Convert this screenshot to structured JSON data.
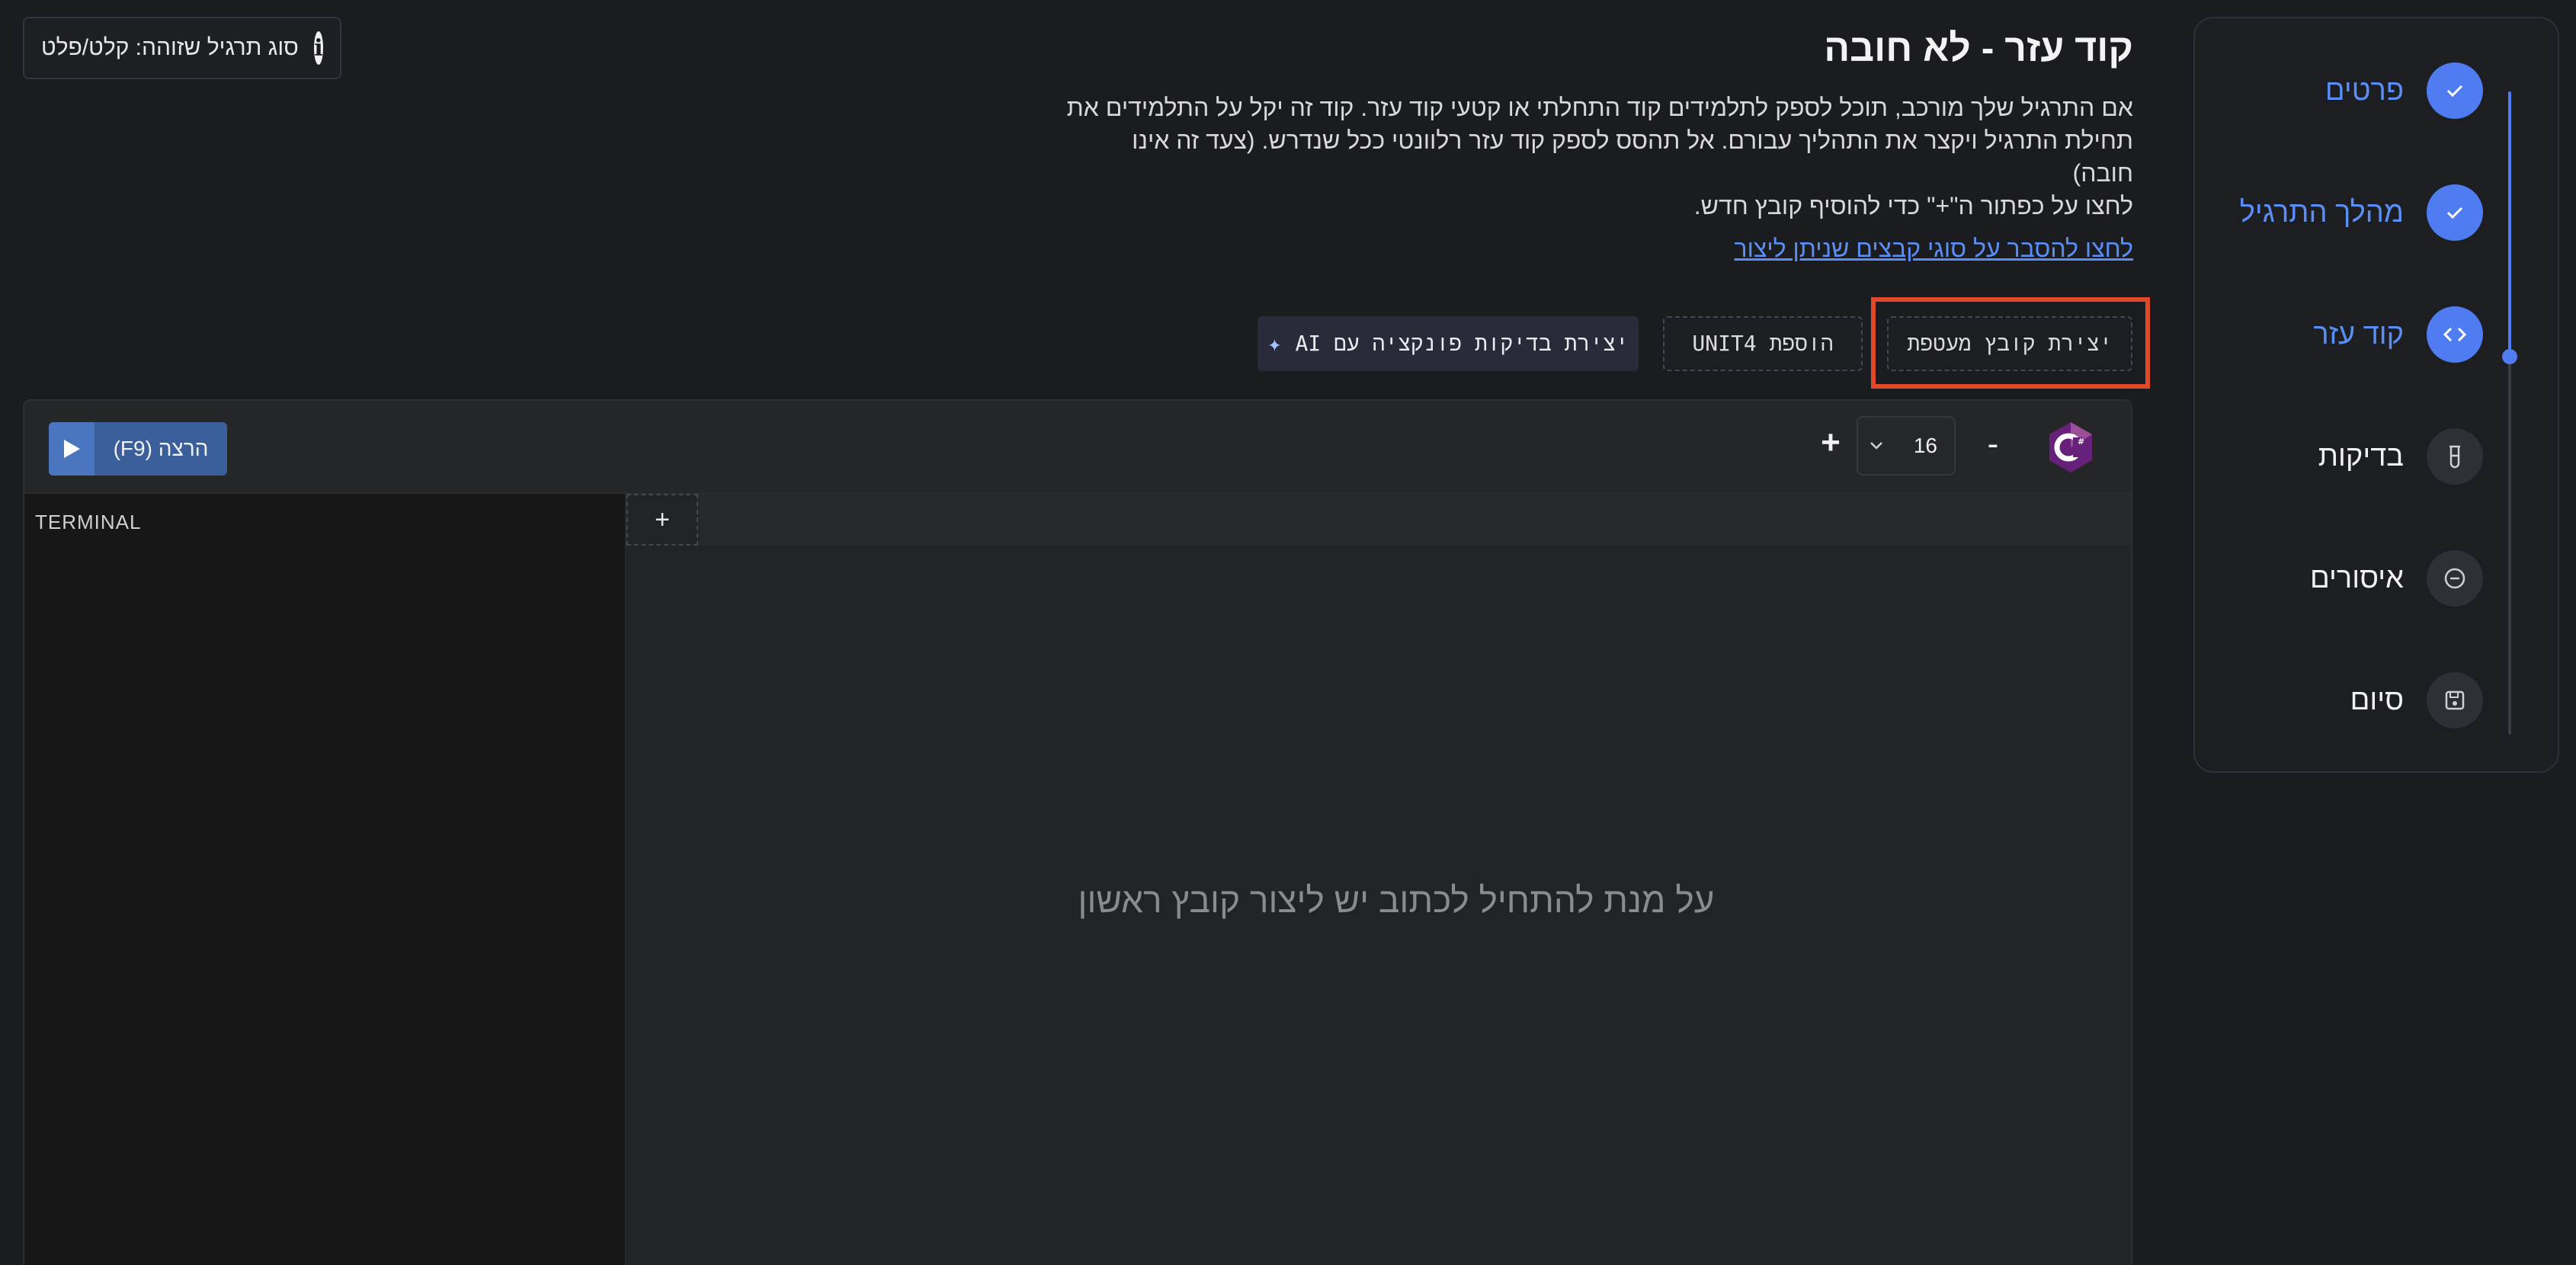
{
  "exercise_type": {
    "info_icon": "info-circle-icon",
    "label": "סוג תרגיל שזוהה: קלט/פלט"
  },
  "header": {
    "title": "קוד עזר - לא חובה",
    "description_lines": [
      "אם התרגיל שלך מורכב, תוכל לספק לתלמידים קוד התחלתי או קטעי קוד עזר. קוד זה יקל על התלמידים את",
      "תחילת התרגיל ויקצר את התהליך עבורם. אל תהסס לספק קוד עזר רלוונטי ככל שנדרש. (צעד זה אינו",
      "חובה)",
      "לחצו על כפתור ה\"+\" כדי להוסיף קובץ חדש."
    ],
    "link": "לחצו להסבר על סוגי קבצים שניתן ליצור"
  },
  "actions": {
    "create_wrapper": "יצירת קובץ מעטפת",
    "add_unit4": "הוספת UNIT4",
    "ai_tests": "יצירת בדיקות פונקציה עם AI"
  },
  "editor": {
    "run_label": "הרצה (F9)",
    "font_size": "16",
    "language": "C#",
    "terminal_label": "TERMINAL",
    "add_tab": "+",
    "empty_message": "על מנת להתחיל לכתוב יש ליצור קובץ ראשון",
    "minus": "-",
    "plus": "+"
  },
  "stepper": {
    "steps": [
      {
        "label": "פרטים",
        "state": "done",
        "icon": "check-icon"
      },
      {
        "label": "מהלך התרגיל",
        "state": "done",
        "icon": "check-icon"
      },
      {
        "label": "קוד עזר",
        "state": "active",
        "icon": "code-icon"
      },
      {
        "label": "בדיקות",
        "state": "pending",
        "icon": "test-tube-icon"
      },
      {
        "label": "איסורים",
        "state": "pending",
        "icon": "minus-circle-icon"
      },
      {
        "label": "סיום",
        "state": "pending",
        "icon": "save-icon"
      }
    ]
  },
  "colors": {
    "accent": "#4f7cf0",
    "highlight": "#e04a2c",
    "background": "#1b1c1f"
  }
}
